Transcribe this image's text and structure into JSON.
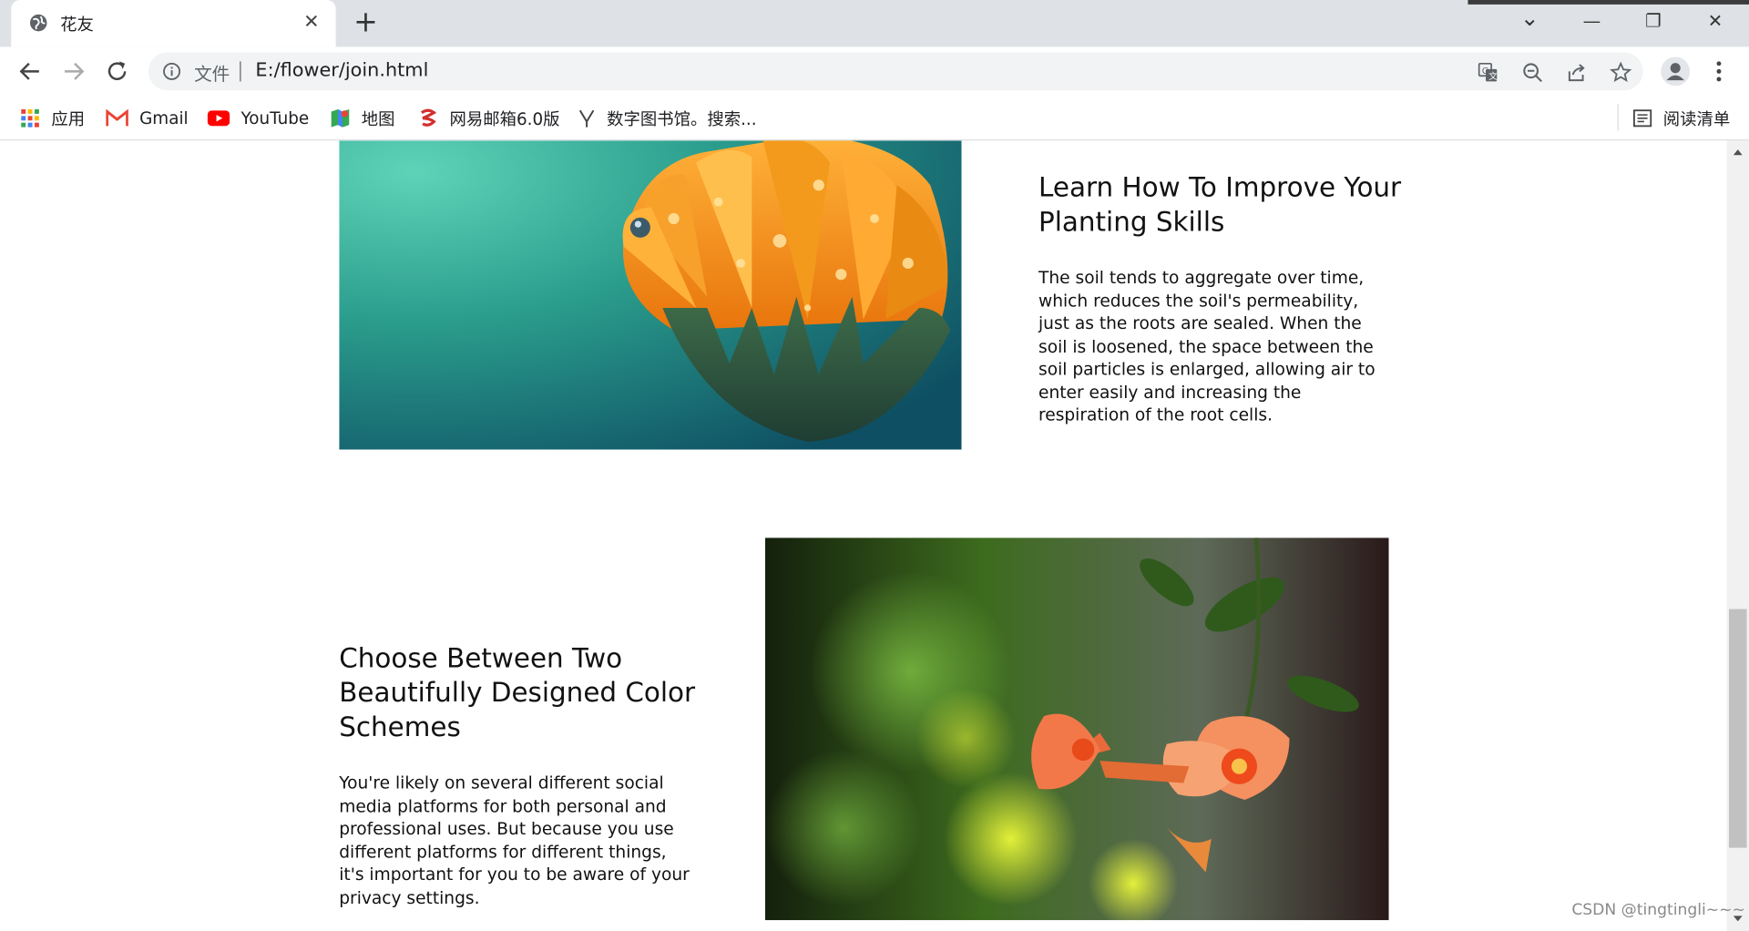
{
  "browser": {
    "tab_title": "花友",
    "close_glyph": "✕",
    "newtab_glyph": "+",
    "window_buttons": {
      "tabsearch": "⌄",
      "minimize": "—",
      "restore": "❐",
      "close": "✕"
    },
    "scheme_label": "文件",
    "url": "E:/flower/join.html",
    "icons": [
      "globe-icon",
      "close-icon",
      "plus-icon",
      "back-icon",
      "forward-icon",
      "reload-icon",
      "info-icon",
      "translate-icon",
      "zoom-icon",
      "share-icon",
      "star-icon",
      "profile-icon",
      "menu-icon",
      "reading-list-icon"
    ]
  },
  "bookmarks": {
    "items": [
      {
        "label": "应用",
        "icon": "apps-grid-icon"
      },
      {
        "label": "Gmail",
        "icon": "gmail-icon"
      },
      {
        "label": "YouTube",
        "icon": "youtube-icon"
      },
      {
        "label": "地图",
        "icon": "maps-icon"
      },
      {
        "label": "网易邮箱6.0版",
        "icon": "netease-icon"
      },
      {
        "label": "数字图书馆。搜索...",
        "icon": "library-icon"
      }
    ],
    "reading_list": "阅读清单"
  },
  "sections": [
    {
      "heading": "Learn How To Improve Your Planting Skills",
      "body": "The soil tends to aggregate over time, which reduces the soil's permeability, just as the roots are sealed. When the soil is loosened, the space between the soil particles is enlarged, allowing air to enter easily and increasing the respiration of the root cells."
    },
    {
      "heading": "Choose Between Two Beautifully Designed Color Schemes",
      "body": "You're likely on several different social media platforms for both personal and professional uses. But because you use different platforms for different things, it's important for you to be aware of your privacy settings."
    }
  ],
  "watermark": "CSDN @tingtingli~~~",
  "colors": {
    "accent_orange": "#f39a1c",
    "teal": "#2a9c8c",
    "leaf_green": "#3d6b1e",
    "trumpet_coral": "#f2784a"
  }
}
